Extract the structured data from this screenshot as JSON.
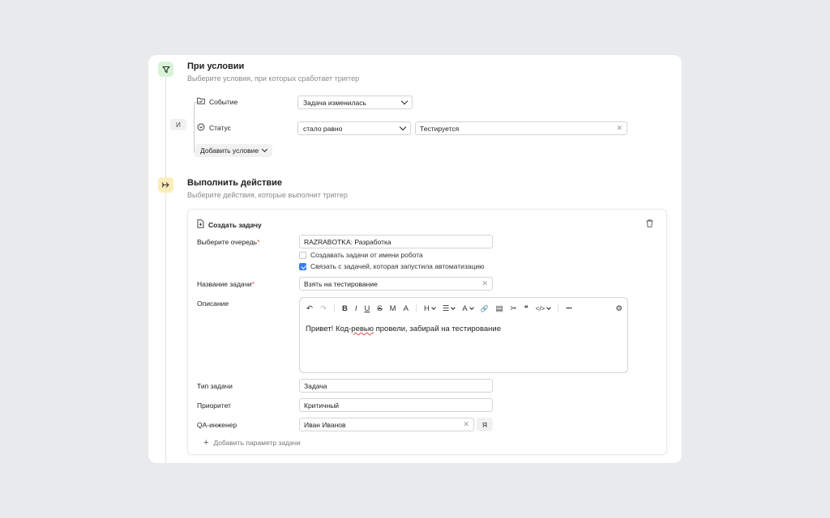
{
  "condition": {
    "title": "При условии",
    "subtitle": "Выберите условия, при которых сработает триггер",
    "and_label": "И",
    "rows": [
      {
        "label": "Событие",
        "select": "Задача изменилась"
      },
      {
        "label": "Статус",
        "select": "стало равно",
        "value": "Тестируется"
      }
    ],
    "add_label": "Добавить условие"
  },
  "action": {
    "title": "Выполнить действие",
    "subtitle": "Выберите действия, которые выполнит триггер",
    "card_title": "Создать задачу",
    "queue_label": "Выберите очередь",
    "queue_value": "RAZRABOTKA: Разработка",
    "check_robot": "Создавать задачи от имени робота",
    "check_link": "Связать с задачей, которая запустила автоматизацию",
    "check_robot_checked": false,
    "check_link_checked": true,
    "name_label": "Название задачи",
    "name_value": "Взять на тестирование",
    "desc_label": "Описание",
    "desc_text_a": "Привет! Код-",
    "desc_text_b": "ревью",
    "desc_text_c": " провели, забирай на тестирование",
    "type_label": "Тип задачи",
    "type_value": "Задача",
    "priority_label": "Приоритет",
    "priority_value": "Критичный",
    "qa_label": "QA-инженер",
    "qa_value": "Иван Иванов",
    "qa_me_button": "Я",
    "add_param": "Добавить параметр задачи",
    "required_mark": "*"
  },
  "toolbar": {
    "undo": "↶",
    "redo": "↷",
    "bold": "B",
    "italic": "I",
    "underline": "U",
    "strike": "S",
    "mono": "M",
    "textsize": "A",
    "heading": "H",
    "list": "☰",
    "color": "A",
    "link": "🔗",
    "note": "▤",
    "cut": "✂",
    "quote": "❝",
    "code": "</>",
    "more": "•••",
    "settings": "⚙"
  },
  "colors": {
    "condition_icon_bg": "#d9f3d9",
    "action_icon_bg": "#fbedb8",
    "checkbox_accent": "#3d7bf0"
  }
}
